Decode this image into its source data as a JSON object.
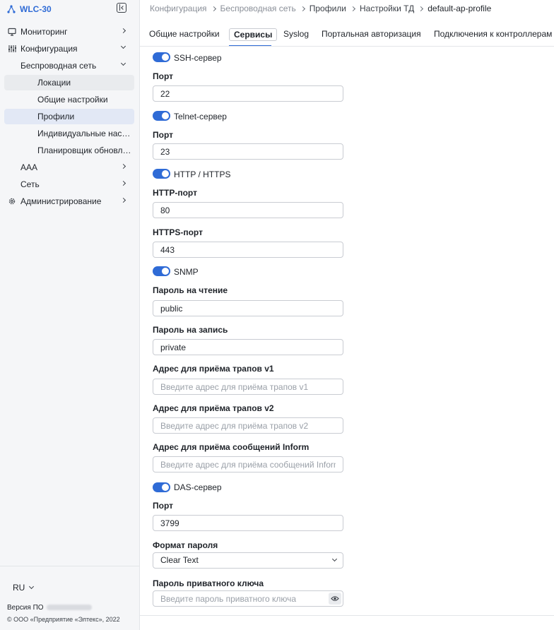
{
  "app": {
    "title": "WLC-30"
  },
  "sidebar": {
    "items": [
      {
        "label": "Мониторинг",
        "icon": "monitor-icon"
      },
      {
        "label": "Конфигурация",
        "icon": "sliders-icon"
      },
      {
        "label": "Беспроводная сеть"
      },
      {
        "label": "Локации"
      },
      {
        "label": "Общие настройки"
      },
      {
        "label": "Профили"
      },
      {
        "label": "Индивидуальные настройки"
      },
      {
        "label": "Планировщик обновлений"
      },
      {
        "label": "AAA"
      },
      {
        "label": "Сеть"
      },
      {
        "label": "Администрирование",
        "icon": "gear-icon"
      }
    ],
    "language": "RU",
    "version_label": "Версия ПО",
    "copyright": "© ООО «Предприятие «Элтекс», 2022"
  },
  "breadcrumb": [
    "Конфигурация",
    "Беспроводная сеть",
    "Профили",
    "Настройки ТД",
    "default-ap-profile"
  ],
  "tabs": [
    "Общие настройки",
    "Сервисы",
    "Syslog",
    "Портальная авторизация",
    "Подключения к контроллерам"
  ],
  "form": {
    "ssh": {
      "label": "SSH-сервер",
      "enabled": true,
      "port_label": "Порт",
      "port": "22"
    },
    "telnet": {
      "label": "Telnet-сервер",
      "enabled": true,
      "port_label": "Порт",
      "port": "23"
    },
    "http": {
      "label": "HTTP / HTTPS",
      "enabled": true,
      "http_port_label": "HTTP-порт",
      "http_port": "80",
      "https_port_label": "HTTPS-порт",
      "https_port": "443"
    },
    "snmp": {
      "label": "SNMP",
      "enabled": true,
      "read_label": "Пароль на чтение",
      "read": "public",
      "write_label": "Пароль на запись",
      "write": "private",
      "trap_v1_label": "Адрес для приёма трапов v1",
      "trap_v1_placeholder": "Введите адрес для приёма трапов v1",
      "trap_v2_label": "Адрес для приёма трапов v2",
      "trap_v2_placeholder": "Введите адрес для приёма трапов v2",
      "inform_label": "Адрес для приёма сообщений Inform",
      "inform_placeholder": "Введите адрес для приёма сообщений Inform"
    },
    "das": {
      "label": "DAS-сервер",
      "enabled": true,
      "port_label": "Порт",
      "port": "3799",
      "password_format_label": "Формат пароля",
      "password_format": "Clear Text",
      "private_key_label": "Пароль приватного ключа",
      "private_key_placeholder": "Введите пароль приватного ключа"
    }
  },
  "colors": {
    "accent": "#2f6bd6",
    "sidebar_bg": "#f5f6f8",
    "active_item": "#e2e8f5"
  }
}
